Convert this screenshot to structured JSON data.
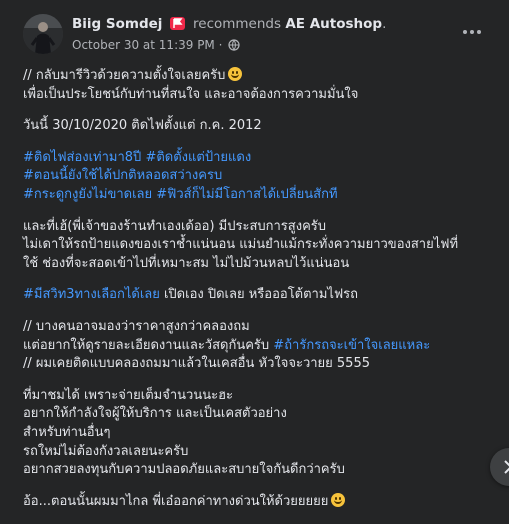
{
  "post": {
    "author": "Biig Somdej",
    "recommend_text": "recommends",
    "page_name": "AE Autoshop",
    "page_suffix": ".",
    "date": "October 30 at 11:39 PM",
    "separator": "·",
    "icons": {
      "recommend": "recommend-flag-icon",
      "privacy": "globe-icon",
      "more": "more-options-icon",
      "nav": "next-arrow-icon"
    },
    "colors": {
      "background": "#242526",
      "hashtag": "#4599ff",
      "recommend_badge": "#f02849"
    }
  },
  "body": {
    "p1": [
      "// กลับมารีวิวด้วยความตั้งใจเลยครับ",
      "เพื่อเป็นประโยชน์กับท่านที่สนใจ และอาจต้องการความมั่นใจ"
    ],
    "p2": "วันนี้ 30/10/2020 ติดไฟตั้งแต่ ก.ค. 2012",
    "p3": [
      "#ติดไฟส่องเท่ามา8ปี #ติดตั้งแต่ป้ายแดง",
      "#ตอนนี้ยังใช้ได้ปกติหลอดสว่างครบ",
      "#กระดูกงูยังไม่ขาดเลย #ฟิวส์ก็ไม่มีโอกาสได้เปลี่ยนสักที"
    ],
    "p4": [
      "และที่เฮ้(พี่เจ้าของร้านทำเองเด้ออ) มีประสบการสูงครับ",
      "ไม่เดาให้รถป้ายแดงของเราช้ำแน่นอน แม่นยำแม้กระทั่งความยาวของสายไฟที่",
      "ใช้ ช่องที่จะสอดเข้าไปที่เหมาะสม ไม่ไปม้วนหลบไว้แน่นอน"
    ],
    "p5_tag": "#มีสวิท3ทางเลือกได้เลย",
    "p5_rest": " เปิดเอง ปิดเลย หรือออโต้ตามไฟรถ",
    "p6_l1": "// บางคนอาจมองว่าราคาสูงกว่าคลองถม",
    "p6_l2_text": "แต่อยากให้ดูรายละเอียดงานและวัสดุกันครับ ",
    "p6_l2_tag": "#ถ้ารักรถจะเข้าใจเลยแหละ",
    "p6_l3": "// ผมเคยติดแบบคลองถมมาแล้วในเคสอื่น หัวใจจะวายย 5555",
    "p7": [
      "ที่มาชมได้ เพราะจ่ายเต็มจำนวนนะฮะ",
      "อยากให้กำลังใจผู้ให้บริการ และเป็นเคสตัวอย่าง",
      "สำหรับท่านอื่นๆ",
      "รถใหม่ไม่ต้องกังวลเลยนะครับ",
      "อยากสวยลงทุนกับความปลอดภัยและสบายใจกันดีกว่าครับ"
    ],
    "p8": "อ้อ...ตอนนั้นผมมาไกล พี่เอ๋ออกค่าทางด่วนให้ด้วยยยยย",
    "emoji_name": "grinning-face-emoji"
  }
}
